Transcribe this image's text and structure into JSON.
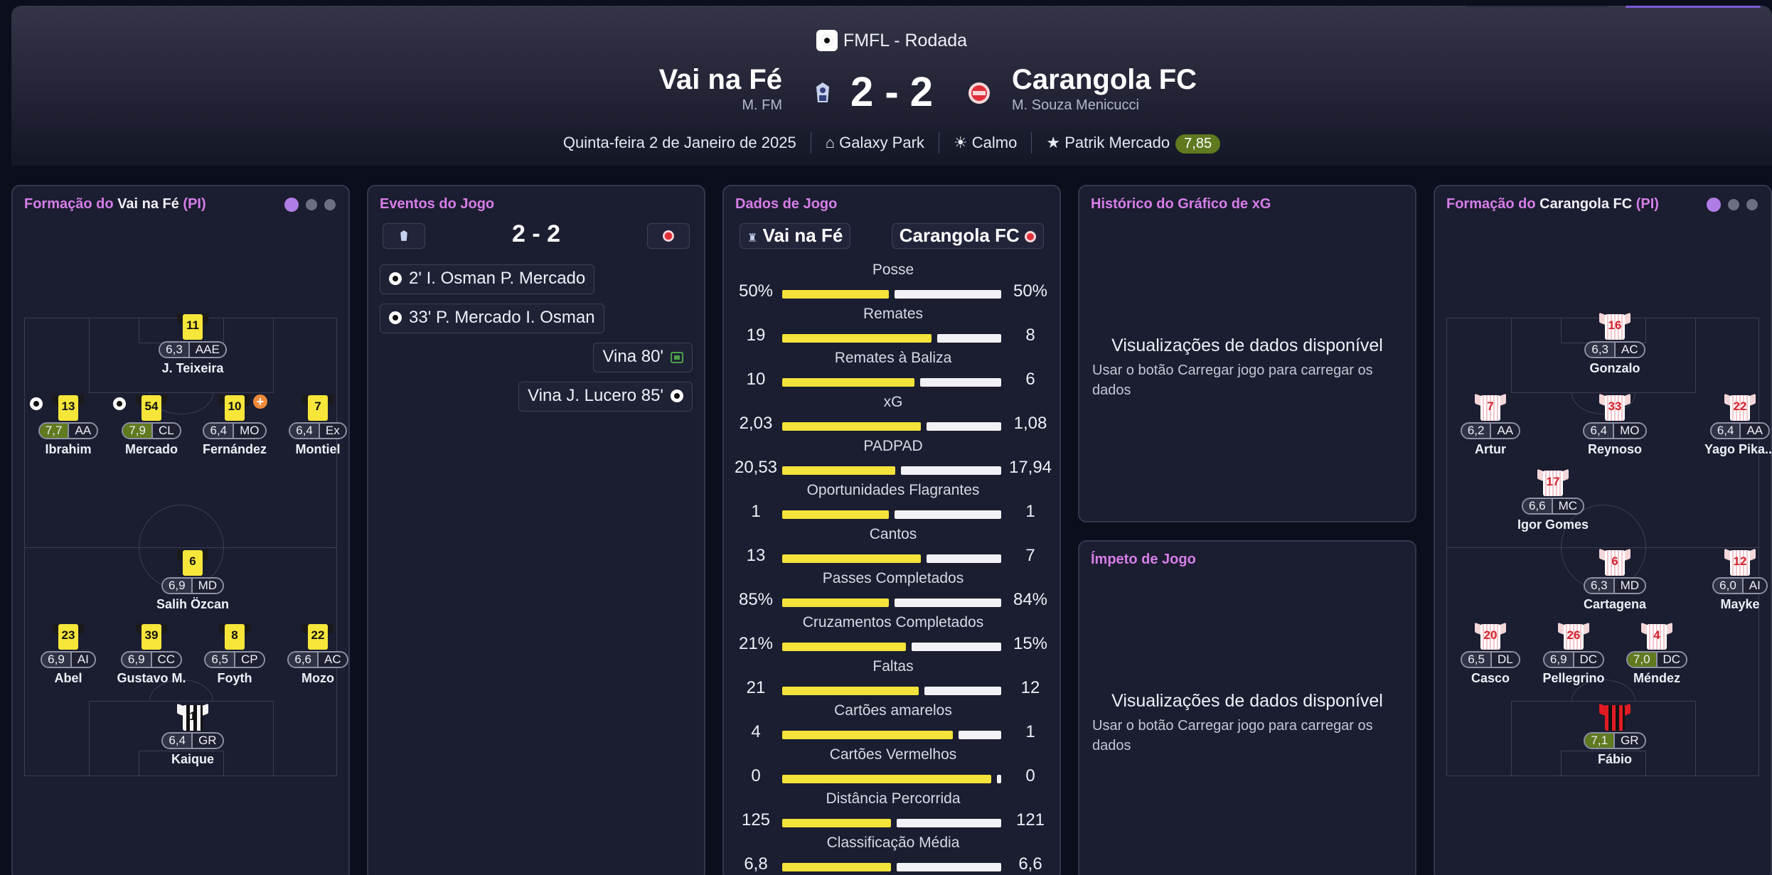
{
  "header": {
    "competition": "FMFL - Rodada",
    "home": {
      "name": "Vai na Fé",
      "manager": "M. FM"
    },
    "away": {
      "name": "Carangola FC",
      "manager": "M. Souza Menicucci"
    },
    "score": "2 - 2",
    "date": "Quinta-feira 2 de Janeiro de 2025",
    "stadium": "Galaxy Park",
    "weather": "Calmo",
    "potm_name": "Patrik Mercado",
    "potm_rating": "7,85"
  },
  "colors": {
    "accent": "#d67ee8",
    "home_kit": "#f6e63a",
    "away_kit": "#d3242f",
    "good_rating": "#5f7a1f"
  },
  "home_formation": {
    "title_prefix": "Formação do",
    "team": "Vai na Fé",
    "suffix": "(PI)",
    "players": [
      {
        "num": "11",
        "rating": "6,3",
        "pos": "AAE",
        "name": "J. Teixeira"
      },
      {
        "num": "13",
        "rating": "7,7",
        "pos": "AA",
        "name": "Ibrahim"
      },
      {
        "num": "54",
        "rating": "7,9",
        "pos": "CL",
        "name": "Mercado"
      },
      {
        "num": "10",
        "rating": "6,4",
        "pos": "MO",
        "name": "Fernández"
      },
      {
        "num": "7",
        "rating": "6,4",
        "pos": "Ex",
        "name": "Montiel"
      },
      {
        "num": "6",
        "rating": "6,9",
        "pos": "MD",
        "name": "Salih Özcan"
      },
      {
        "num": "23",
        "rating": "6,9",
        "pos": "AI",
        "name": "Abel"
      },
      {
        "num": "39",
        "rating": "6,9",
        "pos": "CC",
        "name": "Gustavo M."
      },
      {
        "num": "8",
        "rating": "6,5",
        "pos": "CP",
        "name": "Foyth"
      },
      {
        "num": "22",
        "rating": "6,6",
        "pos": "AC",
        "name": "Mozo"
      },
      {
        "num": "1",
        "rating": "6,4",
        "pos": "GR",
        "name": "Kaique"
      }
    ]
  },
  "away_formation": {
    "title_prefix": "Formação do",
    "team": "Carangola FC",
    "suffix": "(PI)",
    "players": [
      {
        "num": "16",
        "rating": "6,3",
        "pos": "AC",
        "name": "Gonzalo"
      },
      {
        "num": "7",
        "rating": "6,2",
        "pos": "AA",
        "name": "Artur"
      },
      {
        "num": "33",
        "rating": "6,4",
        "pos": "MO",
        "name": "Reynoso"
      },
      {
        "num": "22",
        "rating": "6,4",
        "pos": "AA",
        "name": "Yago Pika..."
      },
      {
        "num": "17",
        "rating": "6,6",
        "pos": "MC",
        "name": "Igor Gomes"
      },
      {
        "num": "6",
        "rating": "6,3",
        "pos": "MD",
        "name": "Cartagena"
      },
      {
        "num": "12",
        "rating": "6,0",
        "pos": "AI",
        "name": "Mayke"
      },
      {
        "num": "20",
        "rating": "6,5",
        "pos": "DL",
        "name": "Casco"
      },
      {
        "num": "26",
        "rating": "6,9",
        "pos": "DC",
        "name": "Pellegrino"
      },
      {
        "num": "4",
        "rating": "7,0",
        "pos": "DC",
        "name": "Méndez"
      },
      {
        "num": "1",
        "rating": "7,1",
        "pos": "GR",
        "name": "Fábio"
      }
    ]
  },
  "events": {
    "title": "Eventos do Jogo",
    "score": "2 - 2",
    "items": [
      {
        "text": "2' I. Osman P. Mercado",
        "side": "home",
        "icon": "goal-icon"
      },
      {
        "text": "33' P. Mercado I. Osman",
        "side": "home",
        "icon": "goal-icon"
      },
      {
        "text": "Vina 80'",
        "side": "away",
        "icon": "substitution-icon"
      },
      {
        "text": "Vina J. Lucero 85'",
        "side": "away",
        "icon": "goal-icon"
      }
    ]
  },
  "stats": {
    "title": "Dados de Jogo",
    "home_label": "Vai na Fé",
    "away_label": "Carangola FC",
    "rows": [
      {
        "label": "Posse",
        "home": "50%",
        "away": "50%",
        "home_share": 0.5
      },
      {
        "label": "Remates",
        "home": "19",
        "away": "8",
        "home_share": 0.7
      },
      {
        "label": "Remates à Baliza",
        "home": "10",
        "away": "6",
        "home_share": 0.62
      },
      {
        "label": "xG",
        "home": "2,03",
        "away": "1,08",
        "home_share": 0.65
      },
      {
        "label": "PADPAD",
        "home": "20,53",
        "away": "17,94",
        "home_share": 0.53
      },
      {
        "label": "Oportunidades Flagrantes",
        "home": "1",
        "away": "1",
        "home_share": 0.5
      },
      {
        "label": "Cantos",
        "home": "13",
        "away": "7",
        "home_share": 0.65
      },
      {
        "label": "Passes Completados",
        "home": "85%",
        "away": "84%",
        "home_share": 0.5
      },
      {
        "label": "Cruzamentos Completados",
        "home": "21%",
        "away": "15%",
        "home_share": 0.58
      },
      {
        "label": "Faltas",
        "home": "21",
        "away": "12",
        "home_share": 0.64
      },
      {
        "label": "Cartões amarelos",
        "home": "4",
        "away": "1",
        "home_share": 0.8
      },
      {
        "label": "Cartões Vermelhos",
        "home": "0",
        "away": "0",
        "home_share": 0.98
      },
      {
        "label": "Distância Percorrida",
        "home": "125",
        "away": "121",
        "home_share": 0.51
      },
      {
        "label": "Classificação Média",
        "home": "6,8",
        "away": "6,6",
        "home_share": 0.51
      }
    ]
  },
  "xg_panel": {
    "title": "Histórico do Gráfico de xG",
    "empty_title": "Visualizações de dados disponível",
    "empty_sub": "Usar o botão Carregar jogo para carregar os dados"
  },
  "momentum_panel": {
    "title": "Ímpeto de Jogo",
    "empty_title": "Visualizações de dados disponível",
    "empty_sub": "Usar o botão Carregar jogo para carregar os dados"
  }
}
